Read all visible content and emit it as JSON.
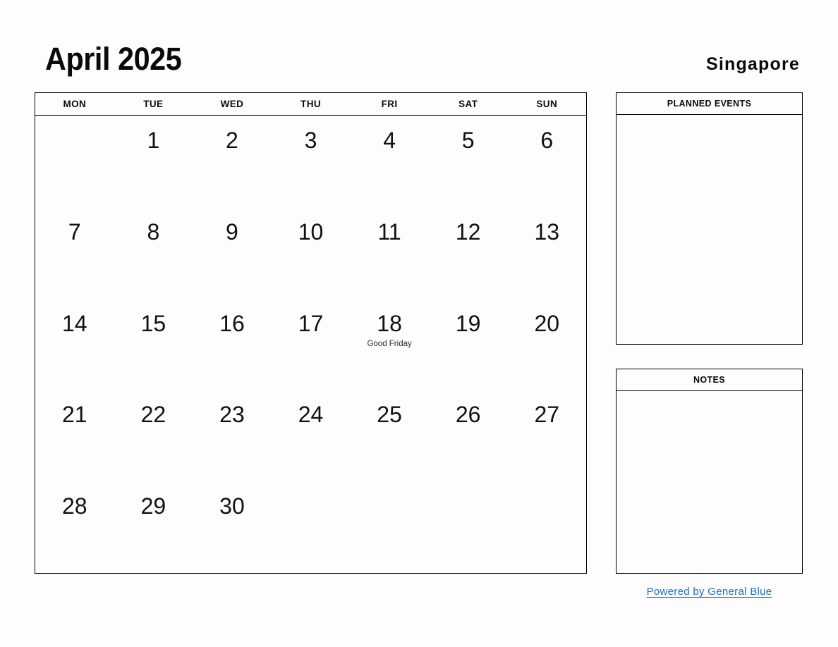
{
  "header": {
    "title": "April 2025",
    "region": "Singapore"
  },
  "calendar": {
    "weekdays": [
      "MON",
      "TUE",
      "WED",
      "THU",
      "FRI",
      "SAT",
      "SUN"
    ],
    "weeks": [
      [
        {
          "day": "",
          "event": ""
        },
        {
          "day": "1",
          "event": ""
        },
        {
          "day": "2",
          "event": ""
        },
        {
          "day": "3",
          "event": ""
        },
        {
          "day": "4",
          "event": ""
        },
        {
          "day": "5",
          "event": ""
        },
        {
          "day": "6",
          "event": ""
        }
      ],
      [
        {
          "day": "7",
          "event": ""
        },
        {
          "day": "8",
          "event": ""
        },
        {
          "day": "9",
          "event": ""
        },
        {
          "day": "10",
          "event": ""
        },
        {
          "day": "11",
          "event": ""
        },
        {
          "day": "12",
          "event": ""
        },
        {
          "day": "13",
          "event": ""
        }
      ],
      [
        {
          "day": "14",
          "event": ""
        },
        {
          "day": "15",
          "event": ""
        },
        {
          "day": "16",
          "event": ""
        },
        {
          "day": "17",
          "event": ""
        },
        {
          "day": "18",
          "event": "Good Friday"
        },
        {
          "day": "19",
          "event": ""
        },
        {
          "day": "20",
          "event": ""
        }
      ],
      [
        {
          "day": "21",
          "event": ""
        },
        {
          "day": "22",
          "event": ""
        },
        {
          "day": "23",
          "event": ""
        },
        {
          "day": "24",
          "event": ""
        },
        {
          "day": "25",
          "event": ""
        },
        {
          "day": "26",
          "event": ""
        },
        {
          "day": "27",
          "event": ""
        }
      ],
      [
        {
          "day": "28",
          "event": ""
        },
        {
          "day": "29",
          "event": ""
        },
        {
          "day": "30",
          "event": ""
        },
        {
          "day": "",
          "event": ""
        },
        {
          "day": "",
          "event": ""
        },
        {
          "day": "",
          "event": ""
        },
        {
          "day": "",
          "event": ""
        }
      ]
    ]
  },
  "panels": {
    "planned_events": {
      "title": "PLANNED EVENTS",
      "content": ""
    },
    "notes": {
      "title": "NOTES",
      "content": ""
    }
  },
  "footer": {
    "link_text": "Powered by General Blue"
  },
  "colors": {
    "link": "#1a6fc4",
    "border": "#000000",
    "background": "#fdfdfd",
    "text": "#0a0a0a"
  }
}
